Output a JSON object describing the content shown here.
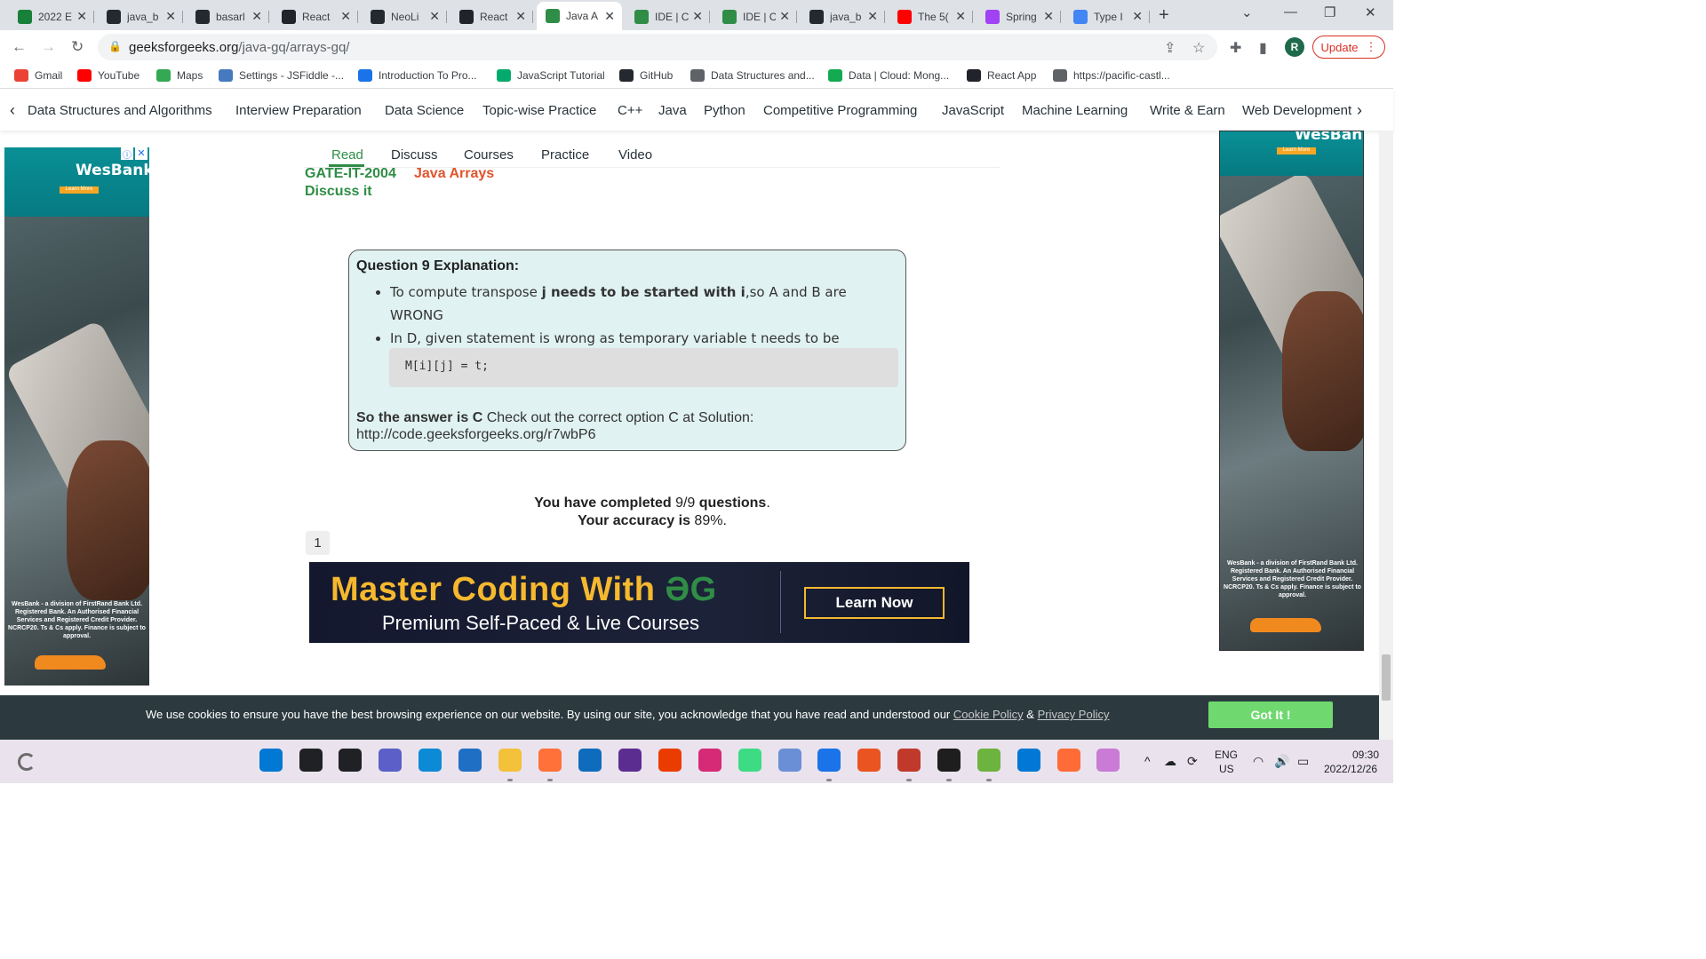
{
  "browser": {
    "tabs": [
      {
        "title": "2022 E",
        "icon": "google-sheets-icon",
        "color": "#188038"
      },
      {
        "title": "java_b",
        "icon": "github-icon",
        "color": "#24292f"
      },
      {
        "title": "basarl",
        "icon": "github-icon",
        "color": "#24292f"
      },
      {
        "title": "React",
        "icon": "react-icon",
        "color": "#20232a"
      },
      {
        "title": "NeoLi",
        "icon": "github-icon",
        "color": "#24292f"
      },
      {
        "title": "React",
        "icon": "react-icon",
        "color": "#20232a"
      },
      {
        "title": "Java A",
        "icon": "gfg-icon",
        "color": "#2f8d46",
        "active": true
      },
      {
        "title": "IDE | C",
        "icon": "gfg-icon",
        "color": "#2f8d46"
      },
      {
        "title": "IDE | C",
        "icon": "gfg-icon",
        "color": "#2f8d46"
      },
      {
        "title": "java_b",
        "icon": "github-icon",
        "color": "#24292f"
      },
      {
        "title": "The 5(",
        "icon": "youtube-icon",
        "color": "#ff0000"
      },
      {
        "title": "Spring",
        "icon": "spring-icon",
        "color": "#a142f4"
      },
      {
        "title": "Type I",
        "icon": "google-icon",
        "color": "#4285f4"
      }
    ],
    "url_host": "geeksforgeeks.org",
    "url_path": "/java-gq/arrays-gq/",
    "profile_initial": "R",
    "update_label": "Update",
    "bookmarks": [
      {
        "label": "Gmail",
        "icon": "gmail-icon",
        "color": "#ea4335"
      },
      {
        "label": "YouTube",
        "icon": "youtube-icon",
        "color": "#ff0000"
      },
      {
        "label": "Maps",
        "icon": "maps-icon",
        "color": "#34a853"
      },
      {
        "label": "Settings - JSFiddle -...",
        "icon": "jsfiddle-icon",
        "color": "#4679bd"
      },
      {
        "label": "Introduction To Pro...",
        "icon": "intro-icon",
        "color": "#1a73e8"
      },
      {
        "label": "JavaScript Tutorial",
        "icon": "w3-icon",
        "color": "#04aa6d"
      },
      {
        "label": "GitHub",
        "icon": "github-icon",
        "color": "#24292f"
      },
      {
        "label": "Data Structures and...",
        "icon": "globe-icon",
        "color": "#5f6368"
      },
      {
        "label": "Data | Cloud: Mong...",
        "icon": "mongodb-icon",
        "color": "#13aa52"
      },
      {
        "label": "React App",
        "icon": "react-icon",
        "color": "#20232a"
      },
      {
        "label": "https://pacific-castl...",
        "icon": "globe-icon",
        "color": "#5f6368"
      }
    ]
  },
  "gfg_nav": [
    "Data Structures and Algorithms",
    "Interview Preparation",
    "Data Science",
    "Topic-wise Practice",
    "C++",
    "Java",
    "Python",
    "Competitive Programming",
    "JavaScript",
    "Machine Learning",
    "Write & Earn",
    "Web Development"
  ],
  "subtabs": [
    "Read",
    "Discuss",
    "Courses",
    "Practice",
    "Video"
  ],
  "topics": {
    "gate": "GATE-IT-2004",
    "arrays": "Java Arrays",
    "discuss": "Discuss it"
  },
  "explanation": {
    "heading": "Question 9 Explanation:",
    "b1_pre": "To compute transpose ",
    "b1_bold": "j needs to be started with i",
    "b1_post": ",so A and B are WRONG",
    "b2": "In D, given statement is wrong as temporary variable t needs to be assigned some value and NOT vice versa",
    "code": "M[i][j] = t;",
    "answer_bold": "So the answer is C",
    "answer_rest": " Check out the correct option C at Solution: http://code.geeksforgeeks.org/r7wbP6"
  },
  "summary": {
    "completed_label": "You have completed",
    "completed_value": "9/9",
    "questions_label": "questions",
    "accuracy_label": "Your accuracy is",
    "accuracy_value": "89%"
  },
  "pagination": "1",
  "banner": {
    "headline": "Master Coding With",
    "sub": "Premium Self-Paced & Live Courses",
    "cta": "Learn Now",
    "accent": "#f5b82e"
  },
  "ads": {
    "brand": "WesBank",
    "learn": "Learn More",
    "disclaimer": "WesBank - a division of FirstRand Bank Ltd. Registered Bank. An Authorised Financial Services and Registered Credit Provider. NCRCP20. Ts & Cs apply. Finance is subject to approval."
  },
  "cookie": {
    "text": "We use cookies to ensure you have the best browsing experience on our website. By using our site, you acknowledge that you have read and understood our",
    "cookie_policy": "Cookie Policy",
    "amp": "&",
    "privacy_policy": "Privacy Policy",
    "button": "Got It !"
  },
  "taskbar": {
    "apps": [
      {
        "icon": "windows-start-icon",
        "color": "#0078d4"
      },
      {
        "icon": "search-icon",
        "color": "#202124"
      },
      {
        "icon": "task-view-icon",
        "color": "#202124"
      },
      {
        "icon": "chat-icon",
        "color": "#5b5fc7"
      },
      {
        "icon": "edge-icon",
        "color": "#0c8ad6"
      },
      {
        "icon": "store-icon",
        "color": "#1f6fc5"
      },
      {
        "icon": "file-explorer-icon",
        "color": "#f3c13a"
      },
      {
        "icon": "firefox-icon",
        "color": "#ff7139"
      },
      {
        "icon": "mail-icon",
        "color": "#0f6cbd"
      },
      {
        "icon": "visual-studio-icon",
        "color": "#5c2d91"
      },
      {
        "icon": "office-icon",
        "color": "#eb3c00"
      },
      {
        "icon": "instagram-icon",
        "color": "#d62976"
      },
      {
        "icon": "android-studio-icon",
        "color": "#3ddc84"
      },
      {
        "icon": "box-icon",
        "color": "#6b8fd6"
      },
      {
        "icon": "chrome-icon",
        "color": "#1a73e8"
      },
      {
        "icon": "ubuntu-icon",
        "color": "#e95420"
      },
      {
        "icon": "pen-icon",
        "color": "#c0392b"
      },
      {
        "icon": "terminal-icon",
        "color": "#1e1e1e"
      },
      {
        "icon": "spring-tools-icon",
        "color": "#6db33f"
      },
      {
        "icon": "vscode-icon",
        "color": "#0078d4"
      },
      {
        "icon": "postman-icon",
        "color": "#ff6c37"
      },
      {
        "icon": "snipping-tool-icon",
        "color": "#c97bd6"
      }
    ],
    "lang": "ENG",
    "region": "US",
    "time": "09:30",
    "date": "2022/12/26"
  }
}
